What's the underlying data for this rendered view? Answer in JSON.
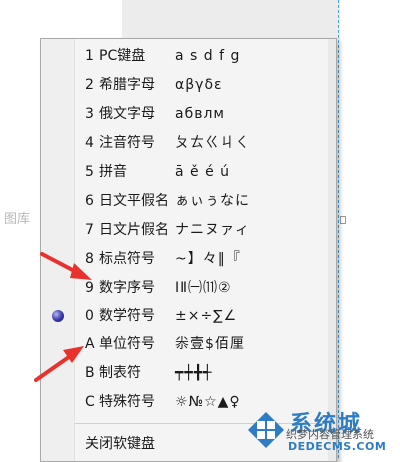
{
  "background": {
    "side_label": "图库"
  },
  "menu": {
    "items": [
      {
        "num": "1",
        "label": "PC键盘",
        "sample": "a s d f g"
      },
      {
        "num": "2",
        "label": "希腊字母",
        "sample": "αβγδε"
      },
      {
        "num": "3",
        "label": "俄文字母",
        "sample": "абвлм"
      },
      {
        "num": "4",
        "label": "注音符号",
        "sample": "ㄆㄊㄍㄐㄑ"
      },
      {
        "num": "5",
        "label": "拼音",
        "sample": "ā ě é ú"
      },
      {
        "num": "6",
        "label": "日文平假名",
        "sample": "ぁぃぅなに"
      },
      {
        "num": "7",
        "label": "日文片假名",
        "sample": "ナニヌァィ"
      },
      {
        "num": "8",
        "label": "标点符号",
        "sample": "~】々‖『"
      },
      {
        "num": "9",
        "label": "数字序号",
        "sample": "ⅠⅡ㈠⑾②"
      },
      {
        "num": "0",
        "label": "数学符号",
        "sample": "±×÷∑∠",
        "selected": true
      },
      {
        "num": "A",
        "label": "单位符号",
        "sample": "尜壹$佰厘"
      },
      {
        "num": "B",
        "label": "制表符",
        "sample": "┯┿╋┽"
      },
      {
        "num": "C",
        "label": "特殊符号",
        "sample": "☼№☆▲♀"
      }
    ],
    "close_label": "关闭软键盘"
  },
  "watermark": {
    "brand": "系统城",
    "subtitle": "织梦内容管理系统",
    "url": "DEDECMS.COM",
    "colors": {
      "brand": "#2e7dc4"
    }
  },
  "colors": {
    "annotation_arrow": "#e8322b",
    "menu_background": "#f4f4f4",
    "selected_dot": "#3333a8"
  }
}
